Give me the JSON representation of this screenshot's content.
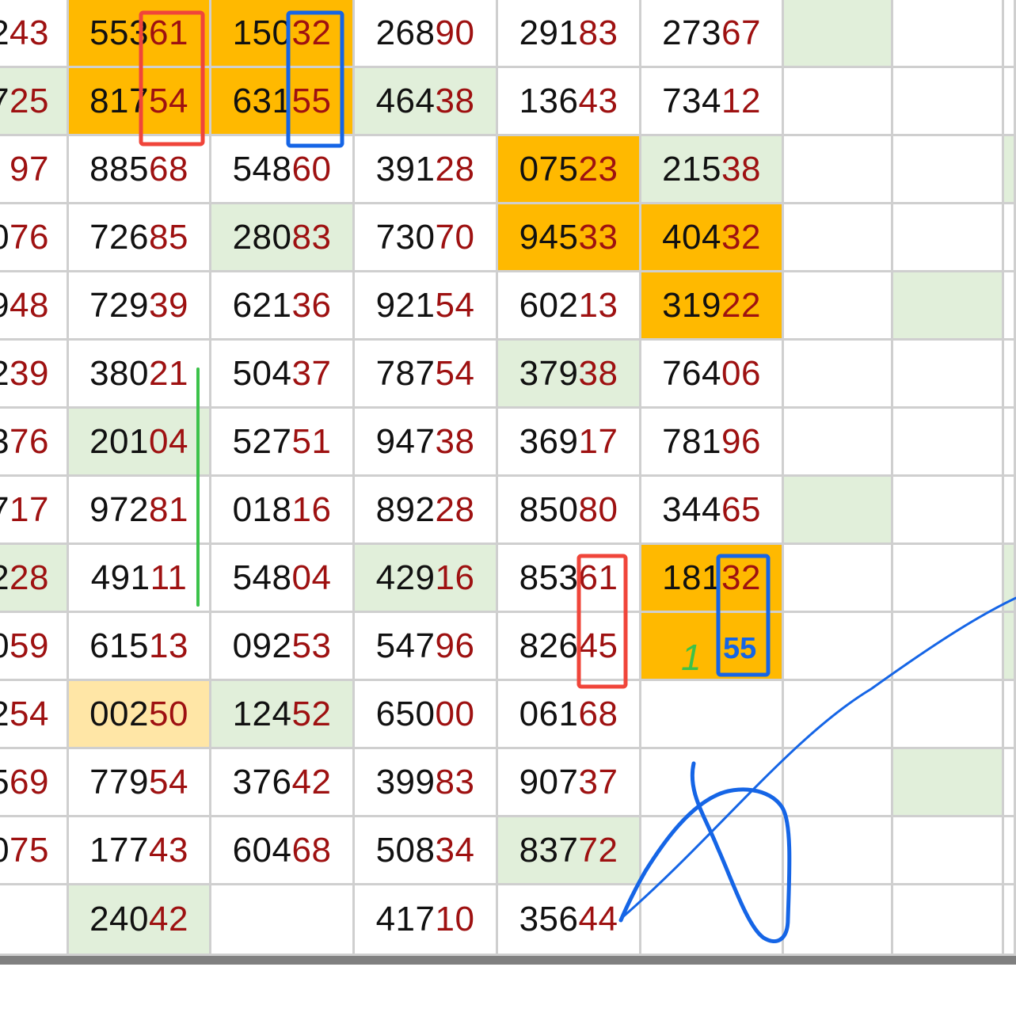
{
  "columns": [
    "c0",
    "c1",
    "c2",
    "c3",
    "c4",
    "c5",
    "c6",
    "c7",
    "c8"
  ],
  "colors": {
    "orange": "#ffb900",
    "green": "#e1efda",
    "yellow": "#ffe6a6",
    "prefix_text": "#111111",
    "suffix_text": "#9e1111",
    "annotation_red": "#f0453a",
    "annotation_blue": "#1565e6",
    "annotation_green": "#3cc24a"
  },
  "rows": [
    [
      {
        "p": "2",
        "s": "43"
      },
      {
        "p": "553",
        "s": "61",
        "bg": "orange"
      },
      {
        "p": "150",
        "s": "32",
        "bg": "orange"
      },
      {
        "p": "268",
        "s": "90"
      },
      {
        "p": "291",
        "s": "83"
      },
      {
        "p": "273",
        "s": "67"
      },
      {
        "bg": "green"
      },
      {},
      {}
    ],
    [
      {
        "p": "7",
        "s": "25",
        "bg": "green"
      },
      {
        "p": "817",
        "s": "54",
        "bg": "orange"
      },
      {
        "p": "631",
        "s": "55",
        "bg": "orange"
      },
      {
        "p": "464",
        "s": "38",
        "bg": "green"
      },
      {
        "p": "136",
        "s": "43"
      },
      {
        "p": "734",
        "s": "12"
      },
      {},
      {},
      {}
    ],
    [
      {
        "p": "",
        "s": "97"
      },
      {
        "p": "885",
        "s": "68"
      },
      {
        "p": "548",
        "s": "60"
      },
      {
        "p": "391",
        "s": "28"
      },
      {
        "p": "075",
        "s": "23",
        "bg": "orange"
      },
      {
        "p": "215",
        "s": "38",
        "bg": "green"
      },
      {},
      {},
      {
        "bg": "green"
      }
    ],
    [
      {
        "p": "0",
        "s": "76"
      },
      {
        "p": "726",
        "s": "85"
      },
      {
        "p": "280",
        "s": "83",
        "bg": "green"
      },
      {
        "p": "730",
        "s": "70"
      },
      {
        "p": "945",
        "s": "33",
        "bg": "orange"
      },
      {
        "p": "404",
        "s": "32",
        "bg": "orange"
      },
      {},
      {},
      {}
    ],
    [
      {
        "p": "9",
        "s": "48"
      },
      {
        "p": "729",
        "s": "39"
      },
      {
        "p": "621",
        "s": "36"
      },
      {
        "p": "921",
        "s": "54"
      },
      {
        "p": "602",
        "s": "13"
      },
      {
        "p": "319",
        "s": "22",
        "bg": "orange"
      },
      {},
      {
        "bg": "green"
      },
      {}
    ],
    [
      {
        "p": "2",
        "s": "39"
      },
      {
        "p": "380",
        "s": "21"
      },
      {
        "p": "504",
        "s": "37"
      },
      {
        "p": "787",
        "s": "54"
      },
      {
        "p": "379",
        "s": "38",
        "bg": "green"
      },
      {
        "p": "764",
        "s": "06"
      },
      {},
      {},
      {}
    ],
    [
      {
        "p": "3",
        "s": "76"
      },
      {
        "p": "201",
        "s": "04",
        "bg": "green"
      },
      {
        "p": "527",
        "s": "51"
      },
      {
        "p": "947",
        "s": "38"
      },
      {
        "p": "369",
        "s": "17"
      },
      {
        "p": "781",
        "s": "96"
      },
      {},
      {},
      {}
    ],
    [
      {
        "p": "7",
        "s": "17"
      },
      {
        "p": "972",
        "s": "81"
      },
      {
        "p": "018",
        "s": "16"
      },
      {
        "p": "892",
        "s": "28"
      },
      {
        "p": "850",
        "s": "80"
      },
      {
        "p": "344",
        "s": "65"
      },
      {
        "bg": "green"
      },
      {},
      {}
    ],
    [
      {
        "p": "2",
        "s": "28",
        "bg": "green"
      },
      {
        "p": "491",
        "s": "11"
      },
      {
        "p": "548",
        "s": "04"
      },
      {
        "p": "429",
        "s": "16",
        "bg": "green"
      },
      {
        "p": "853",
        "s": "61"
      },
      {
        "p": "181",
        "s": "32",
        "bg": "orange"
      },
      {},
      {},
      {
        "bg": "green"
      }
    ],
    [
      {
        "p": "0",
        "s": "59"
      },
      {
        "p": "615",
        "s": "13"
      },
      {
        "p": "092",
        "s": "53"
      },
      {
        "p": "547",
        "s": "96"
      },
      {
        "p": "826",
        "s": "45"
      },
      {
        "bg": "orange"
      },
      {},
      {},
      {
        "bg": "green"
      }
    ],
    [
      {
        "p": "2",
        "s": "54"
      },
      {
        "p": "002",
        "s": "50",
        "bg": "yellow"
      },
      {
        "p": "124",
        "s": "52",
        "bg": "green"
      },
      {
        "p": "650",
        "s": "00"
      },
      {
        "p": "061",
        "s": "68"
      },
      {},
      {},
      {},
      {}
    ],
    [
      {
        "p": "5",
        "s": "69"
      },
      {
        "p": "779",
        "s": "54"
      },
      {
        "p": "376",
        "s": "42"
      },
      {
        "p": "399",
        "s": "83"
      },
      {
        "p": "907",
        "s": "37"
      },
      {},
      {},
      {
        "bg": "green"
      },
      {}
    ],
    [
      {
        "p": "0",
        "s": "75"
      },
      {
        "p": "177",
        "s": "43"
      },
      {
        "p": "604",
        "s": "68"
      },
      {
        "p": "508",
        "s": "34"
      },
      {
        "p": "837",
        "s": "72",
        "bg": "green"
      },
      {},
      {},
      {},
      {}
    ],
    [
      {},
      {
        "p": "240",
        "s": "42",
        "bg": "green"
      },
      {},
      {
        "p": "417",
        "s": "10"
      },
      {
        "p": "356",
        "s": "44"
      },
      {},
      {},
      {},
      {}
    ]
  ],
  "annotations": {
    "handwritten_one": "1",
    "handwritten_fifty_five": "55"
  }
}
